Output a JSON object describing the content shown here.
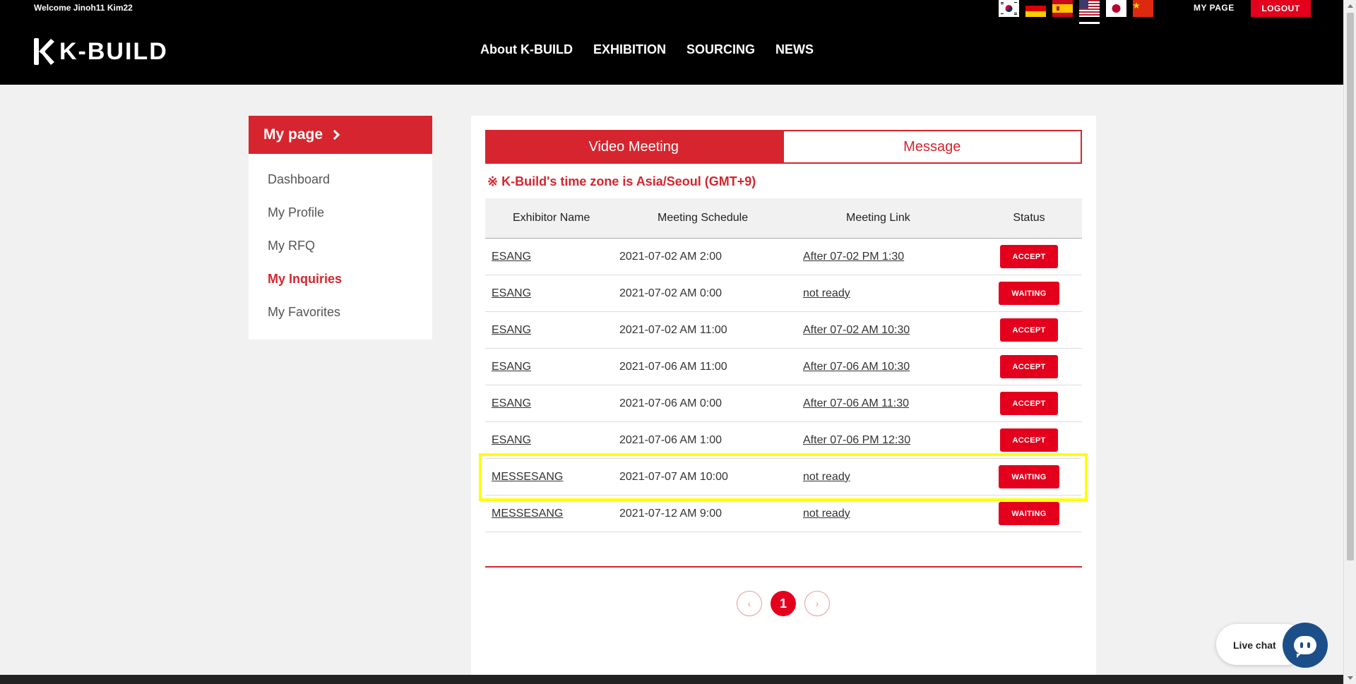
{
  "header": {
    "welcome": "Welcome Jinoh11 Kim22",
    "logo_text": "K-BUILD",
    "nav": [
      "About K-BUILD",
      "EXHIBITION",
      "SOURCING",
      "NEWS"
    ],
    "flags": [
      "korea-flag-icon",
      "germany-flag-icon",
      "spain-flag-icon",
      "usa-flag-icon",
      "japan-flag-icon",
      "china-flag-icon"
    ],
    "my_page": "MY PAGE",
    "logout": "LOGOUT"
  },
  "sidebar": {
    "title": "My page",
    "items": [
      {
        "label": "Dashboard",
        "active": false
      },
      {
        "label": "My Profile",
        "active": false
      },
      {
        "label": "My RFQ",
        "active": false
      },
      {
        "label": "My Inquiries",
        "active": true
      },
      {
        "label": "My Favorites",
        "active": false
      }
    ]
  },
  "main": {
    "tabs": [
      {
        "label": "Video Meeting",
        "active": true
      },
      {
        "label": "Message",
        "active": false
      }
    ],
    "timezone_note": "※ K-Build's time zone is Asia/Seoul (GMT+9)",
    "columns": [
      "Exhibitor Name",
      "Meeting Schedule",
      "Meeting Link",
      "Status"
    ],
    "rows": [
      {
        "exhibitor": "ESANG",
        "schedule": "2021-07-02 AM 2:00",
        "link": "After 07-02 PM 1:30",
        "status": "ACCEPT"
      },
      {
        "exhibitor": "ESANG",
        "schedule": "2021-07-02 AM 0:00",
        "link": "not ready",
        "status": "WAITING"
      },
      {
        "exhibitor": "ESANG",
        "schedule": "2021-07-02 AM 11:00",
        "link": "After 07-02 AM 10:30",
        "status": "ACCEPT"
      },
      {
        "exhibitor": "ESANG",
        "schedule": "2021-07-06 AM 11:00",
        "link": "After 07-06 AM 10:30",
        "status": "ACCEPT"
      },
      {
        "exhibitor": "ESANG",
        "schedule": "2021-07-06 AM 0:00",
        "link": "After 07-06 AM 11:30",
        "status": "ACCEPT"
      },
      {
        "exhibitor": "ESANG",
        "schedule": "2021-07-06 AM 1:00",
        "link": "After 07-06 PM 12:30",
        "status": "ACCEPT"
      },
      {
        "exhibitor": "MESSESANG",
        "schedule": "2021-07-07 AM 10:00",
        "link": "not ready",
        "status": "WAITING"
      },
      {
        "exhibitor": "MESSESANG",
        "schedule": "2021-07-12 AM 9:00",
        "link": "not ready",
        "status": "WAITING"
      }
    ],
    "pagination": {
      "prev": "‹",
      "current": "1",
      "next": "›"
    }
  },
  "livechat": {
    "label": "Live chat"
  },
  "colors": {
    "brand_red": "#d6252e",
    "button_red": "#e4001c",
    "highlight": "#ffff00",
    "chat_blue": "#1c4f8a"
  }
}
